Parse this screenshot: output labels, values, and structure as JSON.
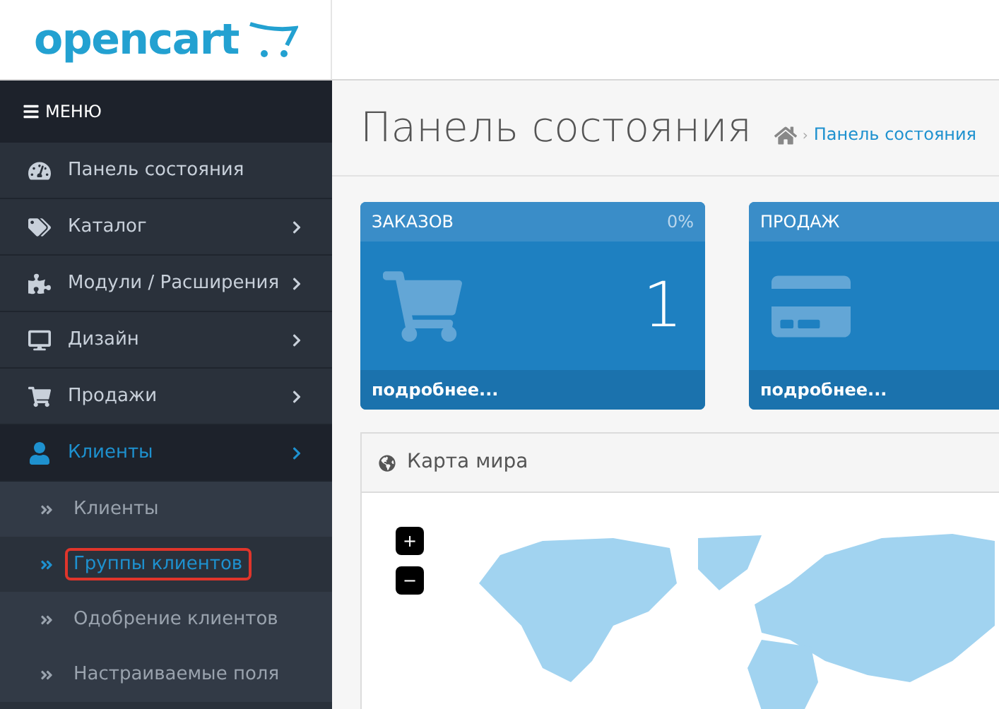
{
  "logo": {
    "text": "opencart"
  },
  "menu": {
    "title": "МЕНЮ",
    "items": [
      {
        "label": "Панель состояния",
        "expandable": false,
        "selected": false
      },
      {
        "label": "Каталог",
        "expandable": true,
        "selected": false
      },
      {
        "label": "Модули / Расширения",
        "expandable": true,
        "selected": false
      },
      {
        "label": "Дизайн",
        "expandable": true,
        "selected": false
      },
      {
        "label": "Продажи",
        "expandable": true,
        "selected": false
      },
      {
        "label": "Клиенты",
        "expandable": true,
        "selected": true,
        "children": [
          {
            "label": "Клиенты",
            "selected": false,
            "highlighted": false
          },
          {
            "label": "Группы клиентов",
            "selected": true,
            "highlighted": true
          },
          {
            "label": "Одобрение клиентов",
            "selected": false,
            "highlighted": false
          },
          {
            "label": "Настраиваемые поля",
            "selected": false,
            "highlighted": false
          }
        ]
      }
    ]
  },
  "page": {
    "title": "Панель состояния",
    "breadcrumb": [
      "Панель состояния"
    ],
    "breadcrumb_separator": "›"
  },
  "tiles": [
    {
      "kind": "orders",
      "title": "ЗАКАЗОВ",
      "percent": "0%",
      "value": "1",
      "footer": "подробнее..."
    },
    {
      "kind": "sales",
      "title": "ПРОДАЖ",
      "footer": "подробнее..."
    }
  ],
  "map_panel": {
    "title": "Карта мира",
    "zoom_buttons": [
      "+",
      "−"
    ]
  }
}
